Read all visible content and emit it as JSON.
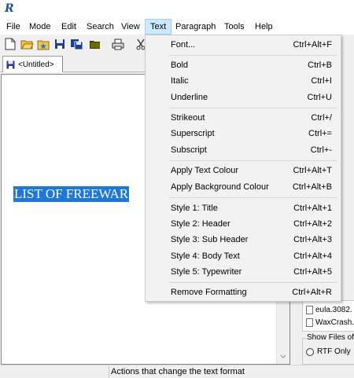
{
  "app": {
    "logo": "R"
  },
  "menubar": {
    "items": [
      {
        "label": "File"
      },
      {
        "label": "Mode"
      },
      {
        "label": "Edit"
      },
      {
        "label": "Search"
      },
      {
        "label": "View"
      },
      {
        "label": "Text"
      },
      {
        "label": "Paragraph"
      },
      {
        "label": "Tools"
      },
      {
        "label": "Help"
      }
    ],
    "active": "Text"
  },
  "toolbar": {
    "icons": [
      "new-document-icon",
      "open-folder-icon",
      "favorites-folder-icon",
      "save-icon",
      "save-all-icon",
      "close-document-icon",
      "print-icon",
      "cut-icon"
    ]
  },
  "tabs": [
    {
      "label": "<Untitled>"
    }
  ],
  "document": {
    "first_line": "LIST OF FREEWAR"
  },
  "text_menu": {
    "font": {
      "label": "Font...",
      "shortcut": "Ctrl+Alt+F"
    },
    "bold": {
      "label": "Bold",
      "shortcut": "Ctrl+B"
    },
    "italic": {
      "label": "Italic",
      "shortcut": "Ctrl+I"
    },
    "underline": {
      "label": "Underline",
      "shortcut": "Ctrl+U"
    },
    "strikeout": {
      "label": "Strikeout",
      "shortcut": "Ctrl+/"
    },
    "superscript": {
      "label": "Superscript",
      "shortcut": "Ctrl+="
    },
    "subscript": {
      "label": "Subscript",
      "shortcut": "Ctrl+-"
    },
    "apply_text_colour": {
      "label": "Apply Text Colour",
      "shortcut": "Ctrl+Alt+T"
    },
    "apply_background_colour": {
      "label": "Apply Background Colour",
      "shortcut": "Ctrl+Alt+B"
    },
    "style1": {
      "label": "Style 1: Title",
      "shortcut": "Ctrl+Alt+1"
    },
    "style2": {
      "label": "Style 2: Header",
      "shortcut": "Ctrl+Alt+2"
    },
    "style3": {
      "label": "Style 3: Sub Header",
      "shortcut": "Ctrl+Alt+3"
    },
    "style4": {
      "label": "Style 4: Body Text",
      "shortcut": "Ctrl+Alt+4"
    },
    "style5": {
      "label": "Style 5: Typewriter",
      "shortcut": "Ctrl+Alt+5"
    },
    "remove_formatting": {
      "label": "Remove Formatting",
      "shortcut": "Ctrl+Alt+R"
    }
  },
  "right_panel": {
    "files": [
      "eula.3082.",
      "WaxCrash."
    ],
    "group_label": "Show Files of",
    "radio_label": "RTF Only"
  },
  "status": {
    "text": "Actions that change the text format"
  },
  "colors": {
    "menu_hover": "#cce8ff",
    "selection": "#1e78dc"
  }
}
